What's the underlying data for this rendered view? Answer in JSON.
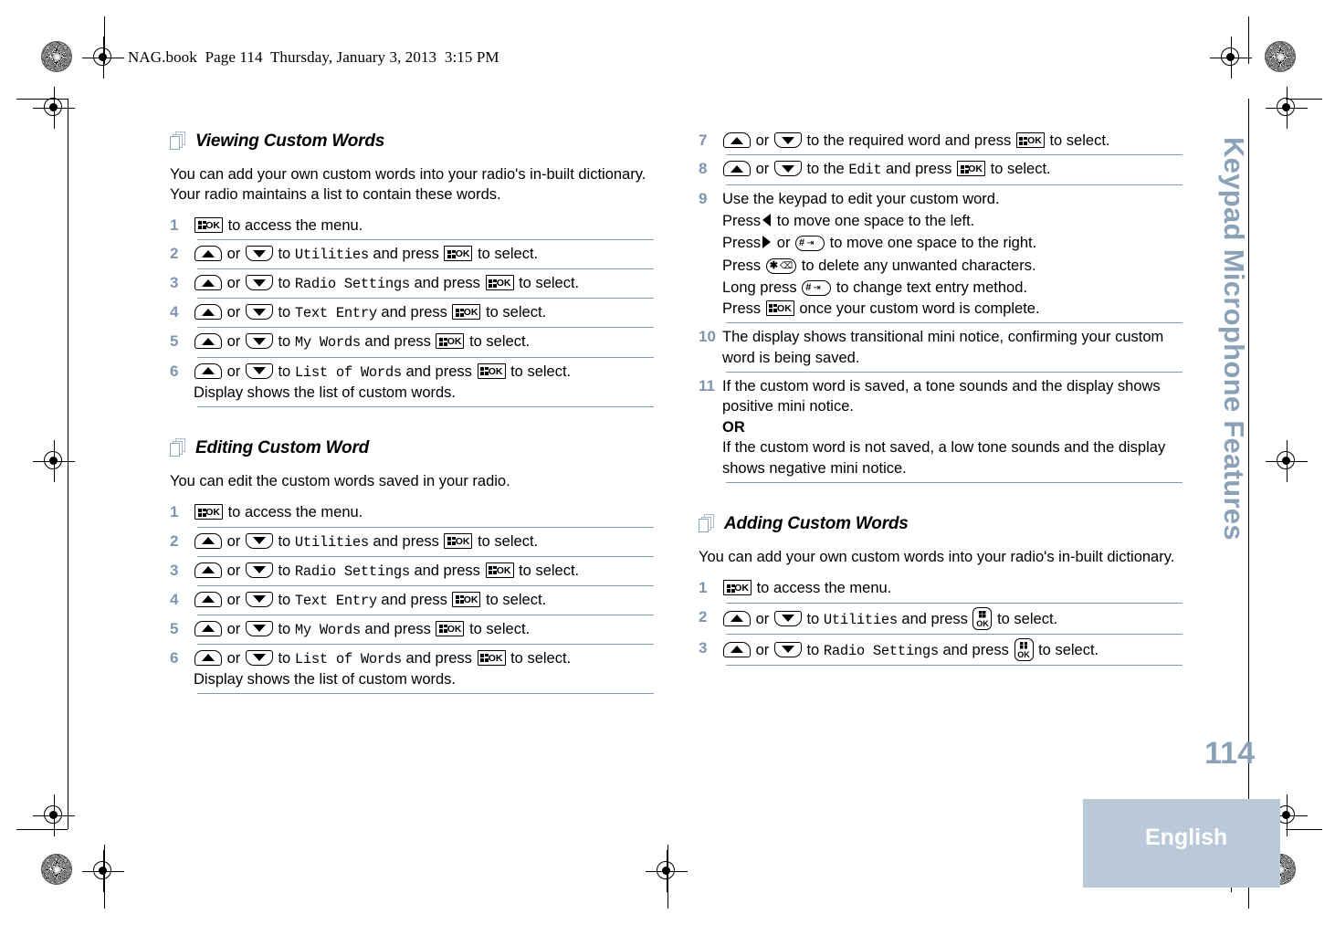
{
  "header": {
    "slug": "NAG.book  Page 114  Thursday, January 3, 2013  3:15 PM"
  },
  "chapter_tab": {
    "label": "Keypad Microphone Features"
  },
  "footer": {
    "page_number": "114",
    "language": "English"
  },
  "colors": {
    "accent_blue": "#8ba1b8",
    "rule_blue": "#7e9ab4",
    "tab_block": "#b9c9d8",
    "icon_outline": "#aab9c9"
  },
  "icons": {
    "pages_icon": "stacked-pages-icon",
    "ok_key": "menu-ok-key-icon",
    "ok_key_vertical": "menu-ok-key-vertical-icon",
    "up_key": "up-arrow-key-icon",
    "down_key": "down-arrow-key-icon",
    "pound_key": "pound-key-icon",
    "star_key": "star-key-icon",
    "left_nav": "left-triangle-icon",
    "right_nav": "right-triangle-icon"
  },
  "left_column": {
    "section1": {
      "title": "Viewing Custom Words",
      "intro": "You can add your own custom words into your radio's in-built dictionary. Your radio maintains a list to contain these words.",
      "steps": [
        {
          "num": "1",
          "t1": "",
          "t2": "to access the menu.",
          "kind": "ok"
        },
        {
          "num": "2",
          "t1": "or",
          "t2": "to",
          "menu": "Utilities",
          "t3": "and press",
          "t4": "to select.",
          "kind": "nav"
        },
        {
          "num": "3",
          "t1": "or",
          "t2": "to",
          "menu": "Radio Settings",
          "t3": "and press",
          "t4": "to select.",
          "kind": "nav"
        },
        {
          "num": "4",
          "t1": "or",
          "t2": "to",
          "menu": "Text Entry",
          "t3": "and press",
          "t4": "to select.",
          "kind": "nav"
        },
        {
          "num": "5",
          "t1": "or",
          "t2": "to",
          "menu": "My Words",
          "t3": "and press",
          "t4": "to select.",
          "kind": "nav"
        },
        {
          "num": "6",
          "t1": "or",
          "t2": "to",
          "menu": "List of Words",
          "t3": "and press",
          "t4": "to select.",
          "extra": "Display shows the list of custom words.",
          "kind": "nav"
        }
      ]
    },
    "section2": {
      "title": "Editing Custom Word",
      "intro": "You can edit the custom words saved in your radio.",
      "steps": [
        {
          "num": "1",
          "t1": "",
          "t2": "to access the menu.",
          "kind": "ok"
        },
        {
          "num": "2",
          "t1": "or",
          "t2": "to",
          "menu": "Utilities",
          "t3": "and press",
          "t4": "to select.",
          "kind": "nav"
        },
        {
          "num": "3",
          "t1": "or",
          "t2": "to",
          "menu": "Radio Settings",
          "t3": "and press",
          "t4": "to select.",
          "kind": "nav"
        },
        {
          "num": "4",
          "t1": "or",
          "t2": "to",
          "menu": "Text Entry",
          "t3": "and press",
          "t4": "to select.",
          "kind": "nav"
        },
        {
          "num": "5",
          "t1": "or",
          "t2": "to",
          "menu": "My Words",
          "t3": "and press",
          "t4": "to select.",
          "kind": "nav"
        },
        {
          "num": "6",
          "t1": "or",
          "t2": "to",
          "menu": "List of Words",
          "t3": "and press",
          "t4": "to select.",
          "extra": "Display shows the list of custom words.",
          "kind": "nav"
        }
      ]
    }
  },
  "right_column": {
    "continued_steps": {
      "step7": {
        "num": "7",
        "t1": "or",
        "t2": "to the required word and press",
        "t3": "to select."
      },
      "step8": {
        "num": "8",
        "t1": "or",
        "t2": "to the",
        "menu": "Edit",
        "t3": "and press",
        "t4": "to select."
      },
      "step9": {
        "num": "9",
        "line1": "Use the keypad to edit your custom word.",
        "line2a": "Press",
        "line2b": "to move one space to the left.",
        "line3a": "Press",
        "line3b": "or",
        "line3c": "to move one space to the right.",
        "line4a": "Press",
        "line4b": "to delete any unwanted characters.",
        "line5a": "Long press",
        "line5b": "to change text entry method.",
        "line6a": "Press",
        "line6b": "once your custom word is complete."
      },
      "step10": {
        "num": "10",
        "text": "The display shows transitional mini notice, confirming your custom word is being saved."
      },
      "step11": {
        "num": "11",
        "line1": "If the custom word is saved, a tone sounds and the display shows positive mini notice.",
        "or": "OR",
        "line2": "If the custom word is not saved, a low tone sounds and the display shows negative mini notice."
      }
    },
    "section3": {
      "title": "Adding Custom Words",
      "intro": "You can add your own custom words into your radio's in-built dictionary.",
      "steps": [
        {
          "num": "1",
          "t1": "",
          "t2": "to access the menu.",
          "kind": "ok"
        },
        {
          "num": "2",
          "t1": "or",
          "t2": "to",
          "menu": "Utilities",
          "t3": "and press",
          "t4": "to select.",
          "kind": "nav"
        },
        {
          "num": "3",
          "t1": "or",
          "t2": "to",
          "menu": "Radio Settings",
          "t3": "and press",
          "t4": "to select.",
          "kind": "nav"
        }
      ]
    }
  }
}
